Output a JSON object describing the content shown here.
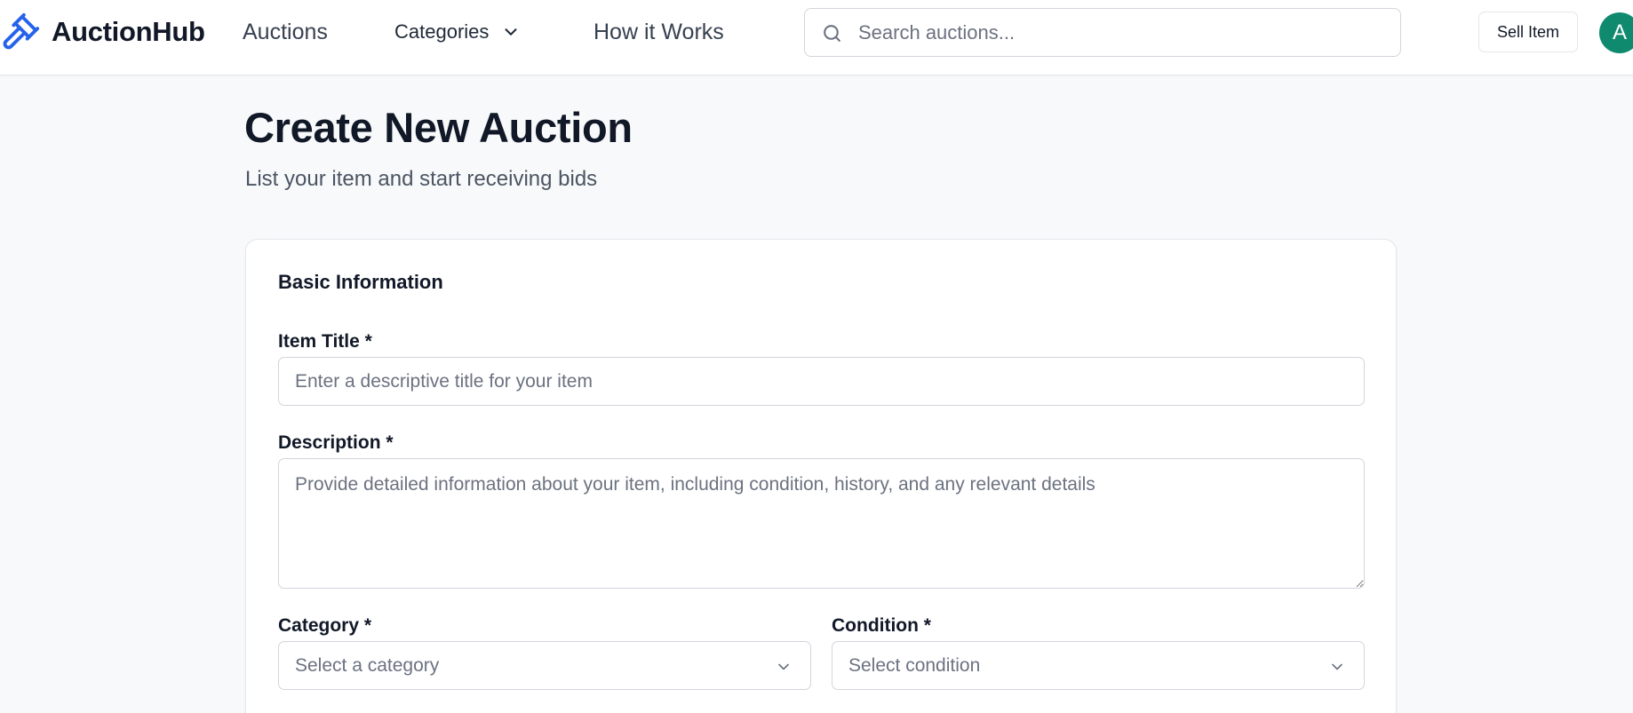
{
  "brand": {
    "name": "AuctionHub",
    "accent": "#2563eb"
  },
  "nav": {
    "auctions": "Auctions",
    "categories": "Categories",
    "how_it_works": "How it Works"
  },
  "search": {
    "placeholder": "Search auctions...",
    "value": ""
  },
  "header": {
    "sell_label": "Sell Item",
    "avatar_initial": "A",
    "avatar_color": "#0f8a6f"
  },
  "page": {
    "title": "Create New Auction",
    "subtitle": "List your item and start receiving bids"
  },
  "form": {
    "section_title": "Basic Information",
    "item_title": {
      "label": "Item Title *",
      "placeholder": "Enter a descriptive title for your item",
      "value": ""
    },
    "description": {
      "label": "Description *",
      "placeholder": "Provide detailed information about your item, including condition, history, and any relevant details",
      "value": ""
    },
    "category": {
      "label": "Category *",
      "placeholder": "Select a category"
    },
    "condition": {
      "label": "Condition *",
      "placeholder": "Select condition"
    }
  },
  "icons": {
    "logo": "gavel-icon",
    "categories_toggle": "chevron-down-icon",
    "search": "search-icon",
    "select": "chevron-down-icon"
  }
}
